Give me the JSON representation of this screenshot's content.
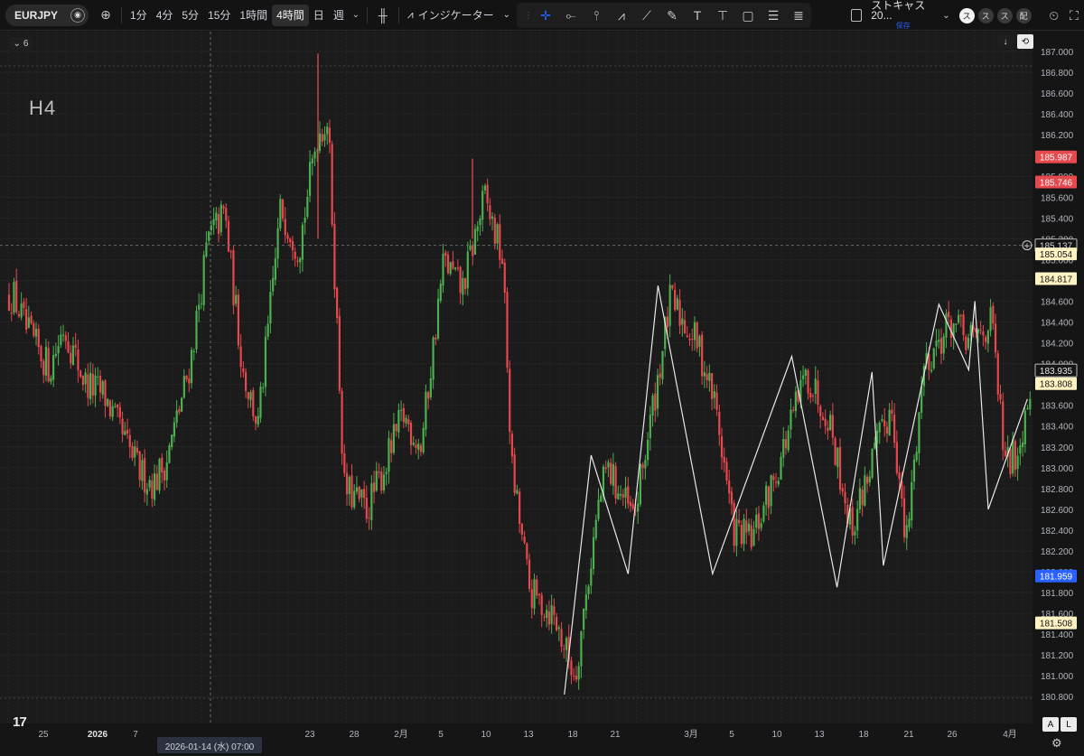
{
  "toolbar": {
    "symbol": "EURJPY",
    "timeframes": [
      "1分",
      "4分",
      "5分",
      "15分",
      "1時間",
      "4時間",
      "日",
      "週"
    ],
    "active_timeframe": "4時間",
    "indicators_label": "インジケーター",
    "text_tool_glyph": "T",
    "layout_name": "ストキャス20...",
    "layout_status": "保存",
    "avatar_labels": [
      "ス",
      "ス",
      "ス",
      "配"
    ]
  },
  "chart": {
    "legend_count": "6",
    "watermark": "H4",
    "tv_logo": "17",
    "price_ticks": [
      "187.000",
      "186.800",
      "186.600",
      "186.400",
      "186.200",
      "186.000",
      "185.800",
      "185.600",
      "185.400",
      "185.200",
      "185.000",
      "184.800",
      "184.600",
      "184.400",
      "184.200",
      "184.000",
      "183.800",
      "183.600",
      "183.400",
      "183.200",
      "183.000",
      "182.800",
      "182.600",
      "182.400",
      "182.200",
      "182.000",
      "181.800",
      "181.600",
      "181.400",
      "181.200",
      "181.000",
      "180.800"
    ],
    "price_labels": [
      {
        "value": "185.987",
        "color": "#e5484d",
        "text_color": "#ffffff"
      },
      {
        "value": "185.746",
        "color": "#e5484d",
        "text_color": "#ffffff"
      },
      {
        "value": "185.137",
        "color": "#151515",
        "text_color": "#d1d4dc"
      },
      {
        "value": "185.054",
        "color": "#fff3c4",
        "text_color": "#111111"
      },
      {
        "value": "184.817",
        "color": "#fff3c4",
        "text_color": "#111111"
      },
      {
        "value": "183.935",
        "color": "#151515",
        "text_color": "#e8e8e8"
      },
      {
        "value": "183.808",
        "color": "#fff3c4",
        "text_color": "#111111"
      },
      {
        "value": "181.959",
        "color": "#2962ff",
        "text_color": "#ffffff"
      },
      {
        "value": "181.508",
        "color": "#fff3c4",
        "text_color": "#111111"
      }
    ],
    "time_ticks": [
      "25",
      "2026",
      "7",
      "23",
      "28",
      "2月",
      "5",
      "10",
      "13",
      "18",
      "21",
      "3月",
      "5",
      "10",
      "13",
      "18",
      "21",
      "26",
      "4月"
    ],
    "crosshair_time": "2026-01-14 (水)   07:00",
    "scale_buttons": [
      "A",
      "L"
    ],
    "crosshair_price": "185.137"
  },
  "chart_data": {
    "type": "candlestick",
    "symbol": "EURJPY",
    "timeframe": "H4",
    "ylim": [
      180.75,
      187.05
    ],
    "zigzag_overlay": [
      {
        "t": 0.545,
        "y": 180.82
      },
      {
        "t": 0.571,
        "y": 183.12
      },
      {
        "t": 0.607,
        "y": 181.98
      },
      {
        "t": 0.636,
        "y": 184.75
      },
      {
        "t": 0.689,
        "y": 181.98
      },
      {
        "t": 0.766,
        "y": 184.07
      },
      {
        "t": 0.81,
        "y": 181.85
      },
      {
        "t": 0.844,
        "y": 183.92
      },
      {
        "t": 0.855,
        "y": 182.06
      },
      {
        "t": 0.909,
        "y": 184.57
      },
      {
        "t": 0.938,
        "y": 183.94
      },
      {
        "t": 0.944,
        "y": 184.6
      },
      {
        "t": 0.957,
        "y": 182.6
      },
      {
        "t": 0.995,
        "y": 183.66
      }
    ],
    "anchor_path": [
      {
        "t": 0.005,
        "y": 184.65
      },
      {
        "t": 0.02,
        "y": 184.3
      },
      {
        "t": 0.045,
        "y": 183.95
      },
      {
        "t": 0.06,
        "y": 184.35
      },
      {
        "t": 0.085,
        "y": 183.8
      },
      {
        "t": 0.105,
        "y": 183.7
      },
      {
        "t": 0.125,
        "y": 183.3
      },
      {
        "t": 0.145,
        "y": 182.95
      },
      {
        "t": 0.16,
        "y": 182.85
      },
      {
        "t": 0.175,
        "y": 183.1
      },
      {
        "t": 0.2,
        "y": 184.0
      },
      {
        "t": 0.22,
        "y": 185.2
      },
      {
        "t": 0.238,
        "y": 185.45
      },
      {
        "t": 0.258,
        "y": 183.95
      },
      {
        "t": 0.275,
        "y": 183.4
      },
      {
        "t": 0.3,
        "y": 185.5
      },
      {
        "t": 0.32,
        "y": 185.1
      },
      {
        "t": 0.34,
        "y": 186.2
      },
      {
        "t": 0.352,
        "y": 186.35
      },
      {
        "t": 0.37,
        "y": 182.8
      },
      {
        "t": 0.395,
        "y": 182.6
      },
      {
        "t": 0.41,
        "y": 182.9
      },
      {
        "t": 0.435,
        "y": 183.5
      },
      {
        "t": 0.455,
        "y": 183.2
      },
      {
        "t": 0.48,
        "y": 185.0
      },
      {
        "t": 0.5,
        "y": 184.7
      },
      {
        "t": 0.525,
        "y": 185.6
      },
      {
        "t": 0.545,
        "y": 185.0
      },
      {
        "t": 0.555,
        "y": 183.0
      },
      {
        "t": 0.575,
        "y": 181.8
      },
      {
        "t": 0.6,
        "y": 181.6
      },
      {
        "t": 0.625,
        "y": 181.0
      },
      {
        "t": 0.65,
        "y": 182.6
      },
      {
        "t": 0.66,
        "y": 183.0
      },
      {
        "t": 0.69,
        "y": 182.5
      },
      {
        "t": 0.715,
        "y": 183.8
      },
      {
        "t": 0.73,
        "y": 184.6
      },
      {
        "t": 0.76,
        "y": 184.2
      },
      {
        "t": 0.78,
        "y": 183.6
      },
      {
        "t": 0.8,
        "y": 182.4
      },
      {
        "t": 0.82,
        "y": 182.3
      },
      {
        "t": 0.845,
        "y": 182.9
      },
      {
        "t": 0.88,
        "y": 183.9
      },
      {
        "t": 0.905,
        "y": 183.5
      },
      {
        "t": 0.93,
        "y": 182.4
      },
      {
        "t": 0.95,
        "y": 183.0
      },
      {
        "t": 0.975,
        "y": 183.6
      },
      {
        "t": 0.99,
        "y": 182.2
      },
      {
        "t": 1.01,
        "y": 184.0
      },
      {
        "t": 1.04,
        "y": 184.4
      },
      {
        "t": 1.06,
        "y": 184.2
      },
      {
        "t": 1.085,
        "y": 184.4
      },
      {
        "t": 1.1,
        "y": 183.0
      },
      {
        "t": 1.115,
        "y": 183.2
      },
      {
        "t": 1.13,
        "y": 183.95
      }
    ],
    "grid": true
  }
}
